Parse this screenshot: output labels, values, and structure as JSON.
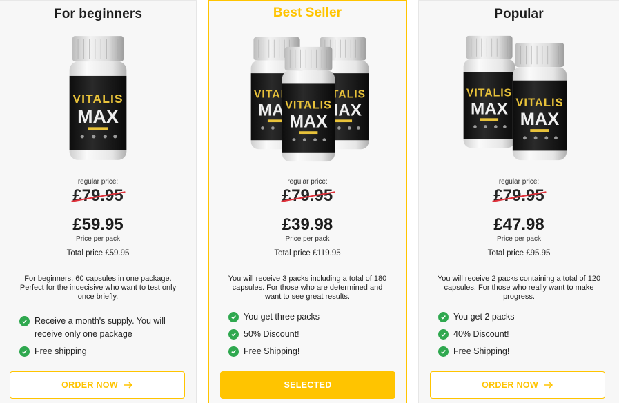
{
  "colors": {
    "accent": "#ffc400",
    "check": "#2fa84f",
    "strike": "#e0303a",
    "bottle_label": "#1a1a1a",
    "brand_text": "#e8c23a"
  },
  "bottle": {
    "brand_top": "VITALIS",
    "brand_bottom": "MAX"
  },
  "cards": [
    {
      "title": "For beginners",
      "regular_label": "regular price:",
      "old_price": "£79.95",
      "price": "£59.95",
      "per_pack": "Price per pack",
      "total": "Total price £59.95",
      "description": "For beginners. 60 capsules in one package. Perfect for the indecisive who want to test only once briefly.",
      "features": [
        "Receive a month's supply. You will receive only one package",
        "Free shipping"
      ],
      "button": "ORDER NOW"
    },
    {
      "title": "Best Seller",
      "regular_label": "regular price:",
      "old_price": "£79.95",
      "price": "£39.98",
      "per_pack": "Price per pack",
      "total": "Total price £119.95",
      "description": "You will receive 3 packs including a total of 180 capsules. For those who are determined and want to see great results.",
      "features": [
        "You get three packs",
        "50% Discount!",
        "Free Shipping!"
      ],
      "button": "SELECTED"
    },
    {
      "title": "Popular",
      "regular_label": "regular price:",
      "old_price": "£79.95",
      "price": "£47.98",
      "per_pack": "Price per pack",
      "total": "Total price £95.95",
      "description": "You will receive 2 packs containing a total of 120 capsules. For those who really want to make progress.",
      "features": [
        "You get 2 packs",
        "40% Discount!",
        "Free Shipping!"
      ],
      "button": "ORDER NOW"
    }
  ]
}
